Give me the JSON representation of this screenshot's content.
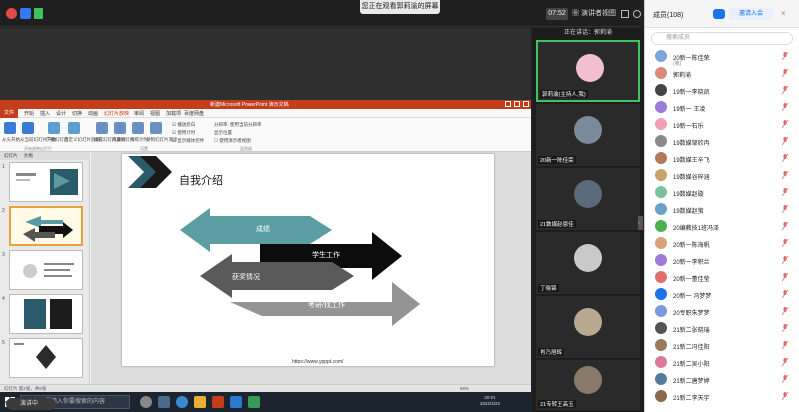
{
  "top": {
    "sharing_notice": "您正在观看郭莉渝的屏幕",
    "time": "07:52",
    "view_mode": "演讲者视图"
  },
  "powerpoint": {
    "window_title": "新建Microsoft PowerPoint 演示文稿",
    "tabs": [
      "文件",
      "开始",
      "插入",
      "设计",
      "切换",
      "动画",
      "幻灯片放映",
      "审阅",
      "视图",
      "加载项",
      "百度网盘"
    ],
    "ribbon": {
      "buttons": [
        "从头开始",
        "从当前幻灯片开始",
        "广播幻灯片",
        "自定义幻灯片放映",
        "设置幻灯片放映",
        "隐藏幻灯片",
        "排练计时",
        "录制幻灯片演示"
      ],
      "checks": [
        "播放旁白",
        "使用计时",
        "显示媒体控件"
      ],
      "monitor_label": "分辨率:",
      "monitor_value": "使用当前分辨率",
      "show_on": "显示位置",
      "presenter_view": "使用演示者视图",
      "groups": [
        "开始放映幻灯片",
        "设置",
        "监视器"
      ]
    },
    "panel_tabs": [
      "幻灯片",
      "大纲"
    ],
    "thumbnails": [
      "1",
      "2",
      "3",
      "4",
      "5"
    ],
    "slide": {
      "title": "自我介绍",
      "arrow_labels": [
        "成绩",
        "学生工作",
        "获奖情况",
        "考研/找工作"
      ],
      "url": "https://www.ypppt.com/"
    },
    "status": {
      "slide_info": "幻灯片 第2张，共5张",
      "zoom": "66%"
    }
  },
  "taskbar": {
    "search_placeholder": "在这里输入你要搜索的内容",
    "clock_time": "20:01",
    "clock_date": "2022/4/22"
  },
  "bottom_pill": "演讲中",
  "videos": {
    "speaking_label": "正在讲话：郭莉渝",
    "tiles": [
      {
        "name": "郭莉渝(主持人,我)"
      },
      {
        "name": "20新一陈佳荣"
      },
      {
        "name": "21数媒赵恩佳"
      },
      {
        "name": "丁晓锦"
      },
      {
        "name": "肖乃旭辉"
      },
      {
        "name": "21专转王高玉"
      }
    ]
  },
  "members": {
    "title": "成员(108)",
    "invite_label": "邀请入会",
    "search_placeholder": "搜索成员",
    "list": [
      {
        "name": "20新一陈佳荣",
        "sub": "(我)",
        "color": "#7aa7d9"
      },
      {
        "name": "郭莉渝",
        "color": "#d98a7a"
      },
      {
        "name": "19新一李晓凯",
        "color": "#444444"
      },
      {
        "name": "19新一 王凌",
        "color": "#9b7ad9"
      },
      {
        "name": "19新一石乐",
        "color": "#f0a0b8"
      },
      {
        "name": "19数媒邹欣冉",
        "color": "#8a8a8a"
      },
      {
        "name": "19数媒王辛飞",
        "color": "#b07a5a"
      },
      {
        "name": "19数媒谷梓涵",
        "color": "#c9a36a"
      },
      {
        "name": "19数媒赵璇",
        "color": "#7ac0a0"
      },
      {
        "name": "19数媒赵萤",
        "color": "#6aa0c9"
      },
      {
        "name": "20编教技1班冯泽",
        "color": "#4caf50"
      },
      {
        "name": "20新一陈海帆",
        "color": "#d9a07a"
      },
      {
        "name": "20新一李积兰",
        "color": "#a07ad9"
      },
      {
        "name": "20新一董佳莹",
        "color": "#e07070"
      },
      {
        "name": "20新一 冯梦梦",
        "color": "#1a73e8"
      },
      {
        "name": "20专职朱梦梦",
        "color": "#7a9ad9"
      },
      {
        "name": "21新二张晓瑞",
        "color": "#555555"
      },
      {
        "name": "21新二冯佳阳",
        "color": "#9a7a5a"
      },
      {
        "name": "21新二吴小阳",
        "color": "#d97a9a"
      },
      {
        "name": "21新二唐梦婷",
        "color": "#5a7a9a"
      },
      {
        "name": "21新二李天宇",
        "color": "#8a6a4a"
      }
    ]
  }
}
